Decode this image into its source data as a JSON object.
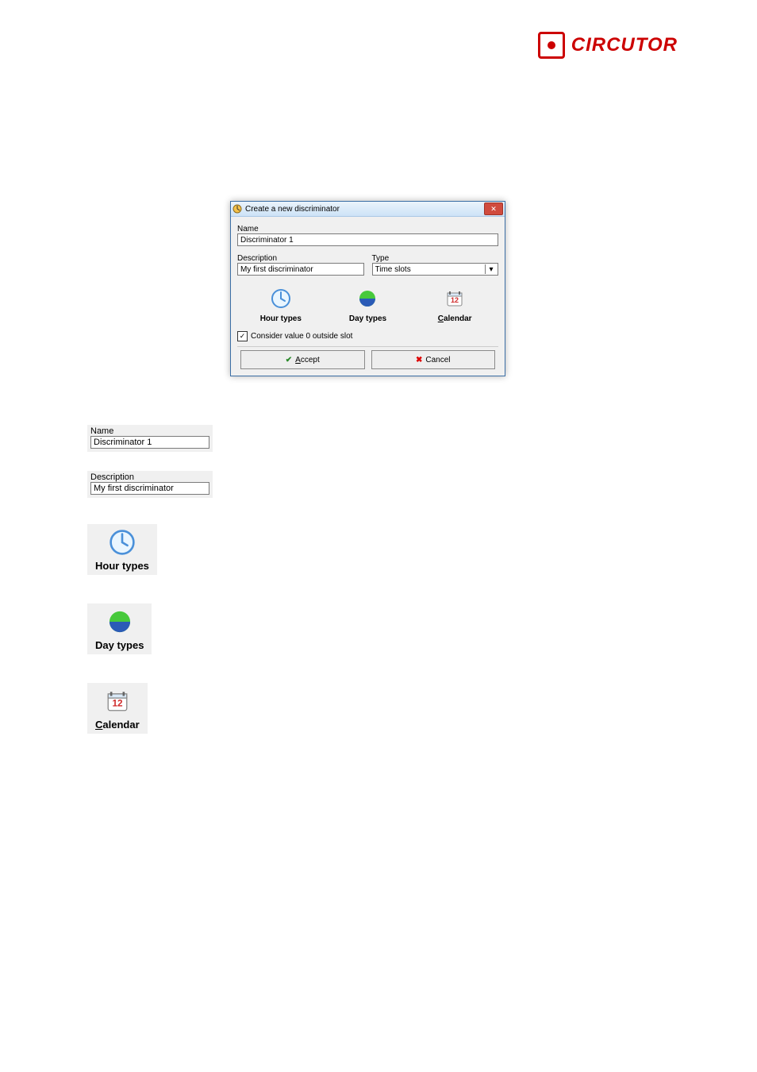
{
  "brand": {
    "name": "CIRCUTOR"
  },
  "dialog": {
    "title": "Create a new discriminator",
    "name_label": "Name",
    "name_value": "Discriminator 1",
    "description_label": "Description",
    "description_value": "My first discriminator",
    "type_label": "Type",
    "type_value": "Time slots",
    "icons": {
      "hour": "Hour types",
      "day": "Day types",
      "calendar_prefix": "C",
      "calendar_rest": "alendar"
    },
    "checkbox_label": "Consider value 0 outside slot",
    "accept_prefix": "A",
    "accept_rest": "ccept",
    "cancel": "Cancel"
  },
  "snippets": {
    "name_label": "Name",
    "name_value": "Discriminator 1",
    "description_label": "Description",
    "description_value": "My first discriminator",
    "hour": "Hour types",
    "day": "Day types",
    "calendar_prefix": "C",
    "calendar_rest": "alendar"
  }
}
